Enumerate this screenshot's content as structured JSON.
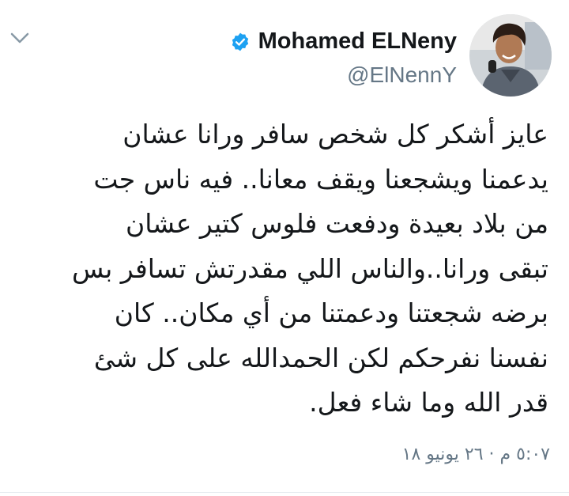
{
  "author": {
    "display_name": "Mohamed ELNeny",
    "handle": "@ElNennY",
    "verified": true
  },
  "icons": {
    "menu": "chevron-down-icon",
    "verified": "verified-badge-icon"
  },
  "tweet": {
    "text": "عايز أشكر كل شخص سافر ورانا عشان\nيدعمنا ويشجعنا ويقف معانا.. فيه ناس جت\nمن بلاد بعيدة ودفعت فلوس كتير عشان\nتبقى ورانا..والناس اللي مقدرتش تسافر بس\nبرضه شجعتنا ودعمتنا من أي مكان.. كان\nنفسنا نفرحكم لكن الحمدالله على كل شئ\nقدر الله وما شاء فعل.",
    "timestamp": "٥:٠٧ م · ٢٦ يونيو ١٨"
  },
  "colors": {
    "verified_blue": "#1da1f2",
    "text": "#14171a",
    "secondary": "#657786"
  }
}
